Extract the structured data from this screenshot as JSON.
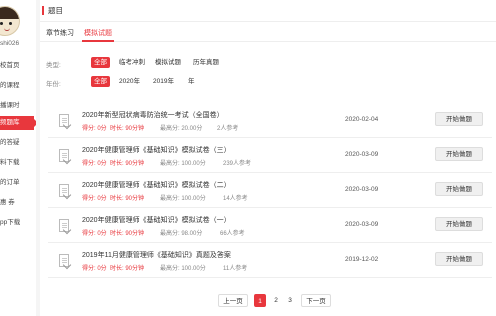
{
  "sidebar": {
    "username": "shi026",
    "items": [
      {
        "label": "校首页"
      },
      {
        "label": "的课程"
      },
      {
        "label": "播课时"
      },
      {
        "label": "频题库",
        "active": true
      },
      {
        "label": "的答疑"
      },
      {
        "label": "料下载"
      },
      {
        "label": "的订单"
      },
      {
        "label": "惠 券"
      },
      {
        "label": "pp下载"
      }
    ]
  },
  "header": {
    "title": "题目"
  },
  "tabs": [
    {
      "label": "章节练习",
      "active": false
    },
    {
      "label": "模拟试题",
      "active": true
    }
  ],
  "filters": {
    "type_label": "类型:",
    "type_options": [
      "全部",
      "临考冲刺",
      "模拟试题",
      "历年真题"
    ],
    "type_selected": "全部",
    "year_label": "年份:",
    "year_options": [
      "全部",
      "2020年",
      "2019年",
      "年"
    ],
    "year_selected": "全部"
  },
  "exams": [
    {
      "title": "2020年新型冠状病毒防治统一考试（全国卷）",
      "score_label": "得分:",
      "score": "0分",
      "duration_label": "时长:",
      "duration": "90分钟",
      "max_label": "最高分:",
      "max": "20.00分",
      "participants": "2人参考",
      "date": "2020-02-04",
      "button": "开始做题"
    },
    {
      "title": "2020年健康管理师《基础知识》模拟试卷（三）",
      "score_label": "得分:",
      "score": "0分",
      "duration_label": "时长:",
      "duration": "90分钟",
      "max_label": "最高分:",
      "max": "100.00分",
      "participants": "239人参考",
      "date": "2020-03-09",
      "button": "开始做题"
    },
    {
      "title": "2020年健康管理师《基础知识》模拟试卷（二）",
      "score_label": "得分:",
      "score": "0分",
      "duration_label": "时长:",
      "duration": "90分钟",
      "max_label": "最高分:",
      "max": "100.00分",
      "participants": "14人参考",
      "date": "2020-03-09",
      "button": "开始做题"
    },
    {
      "title": "2020年健康管理师《基础知识》模拟试卷（一）",
      "score_label": "得分:",
      "score": "0分",
      "duration_label": "时长:",
      "duration": "90分钟",
      "max_label": "最高分:",
      "max": "98.00分",
      "participants": "66人参考",
      "date": "2020-03-09",
      "button": "开始做题"
    },
    {
      "title": "2019年11月健康管理师《基础知识》真题及答案",
      "score_label": "得分:",
      "score": "0分",
      "duration_label": "时长:",
      "duration": "90分钟",
      "max_label": "最高分:",
      "max": "100.00分",
      "participants": "11人参考",
      "date": "2019-12-02",
      "button": "开始做题"
    }
  ],
  "pagination": {
    "prev": "上一页",
    "pages": [
      "1",
      "2",
      "3"
    ],
    "current": "1",
    "next": "下一页"
  },
  "colors": {
    "accent": "#e8373d"
  }
}
